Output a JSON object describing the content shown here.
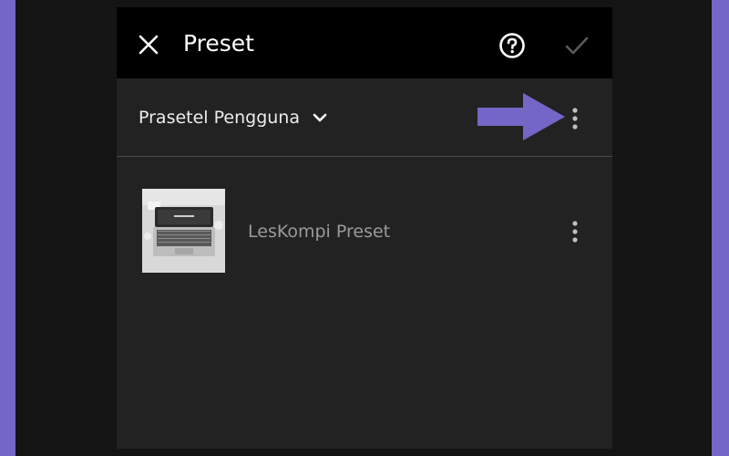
{
  "header": {
    "title": "Preset",
    "close_icon": "close-icon",
    "help_icon": "help-circle-icon",
    "confirm_icon": "checkmark-icon"
  },
  "preset_group": {
    "label": "Prasetel Pengguna",
    "dropdown_icon": "chevron-down-icon",
    "menu_icon": "more-vertical-icon"
  },
  "presets": [
    {
      "name": "LesKompi Preset",
      "thumbnail": "laptop-photo",
      "menu_icon": "more-vertical-icon"
    }
  ],
  "annotation": {
    "icon": "arrow-right-icon",
    "color": "#7366c6"
  },
  "colors": {
    "background_frame": "#7366c6",
    "app_background": "#222222",
    "topbar": "#000000",
    "confirm_disabled": "#5a5a5a"
  }
}
